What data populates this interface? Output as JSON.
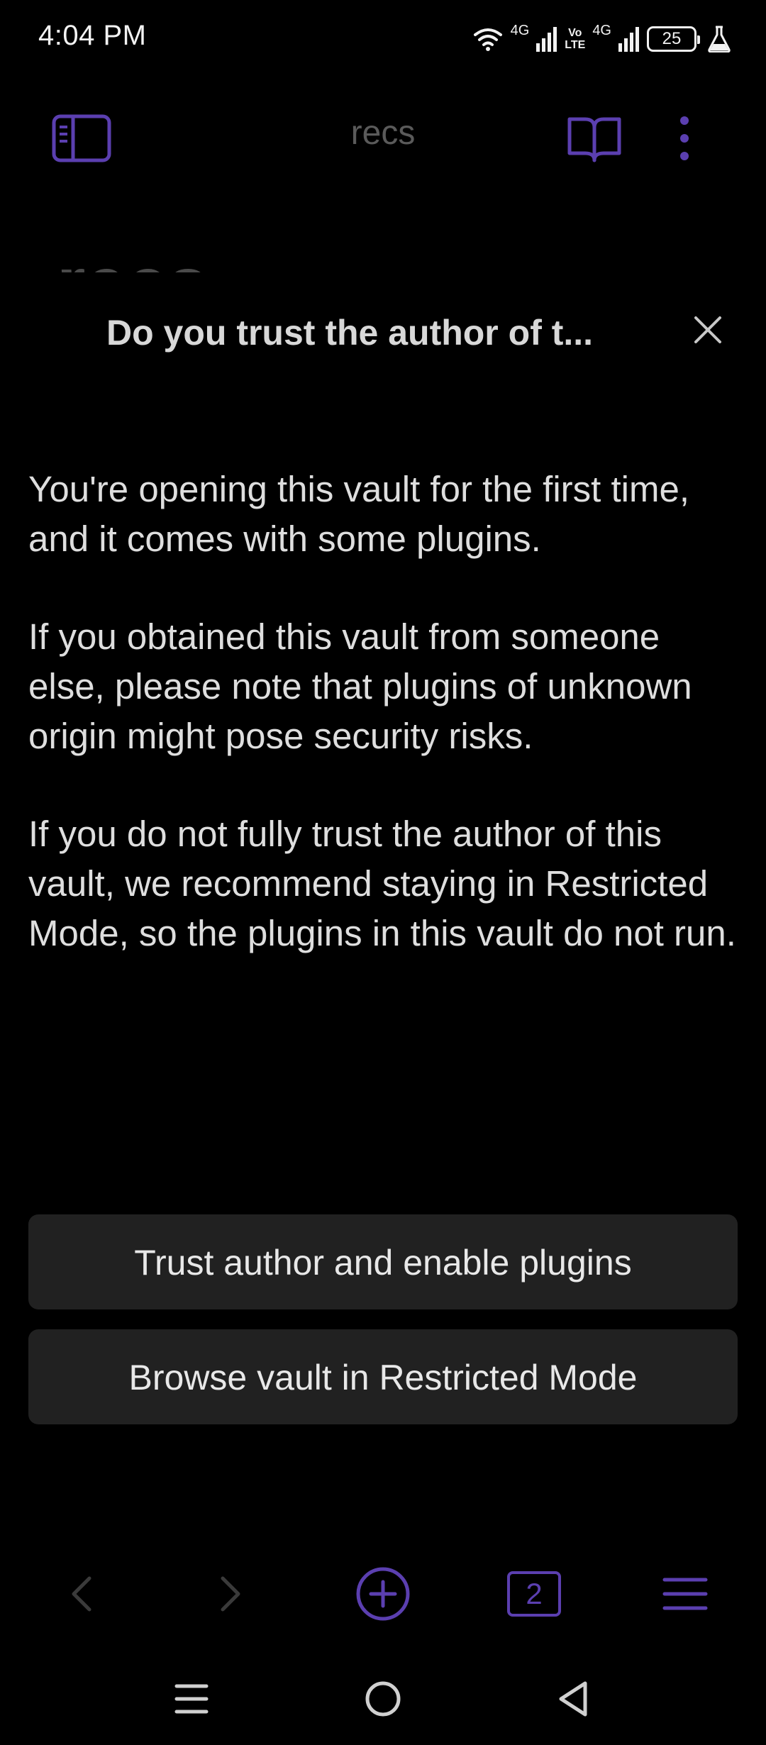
{
  "status_bar": {
    "time": "4:04 PM",
    "network_label_1": "4G",
    "volte_top": "Vo",
    "volte_bottom": "LTE",
    "network_label_2": "4G",
    "battery_level": "25"
  },
  "toolbar": {
    "title": "recs"
  },
  "note": {
    "heading": "recs"
  },
  "modal": {
    "title": "Do you trust the author of t...",
    "paragraphs": [
      "You're opening this vault for the first time, and it comes with some plugins.",
      "If you obtained this vault from someone else, please note that plugins of unknown origin might pose security risks.",
      "If you do not fully trust the author of this vault, we recommend staying in Restricted Mode, so the plugins in this vault do not run."
    ],
    "trust_button": "Trust author and enable plugins",
    "restricted_button": "Browse vault in Restricted Mode"
  },
  "bottom_nav": {
    "tab_count": "2"
  },
  "colors": {
    "background": "#000000",
    "accent": "#5b3fb0",
    "button_bg": "#212121",
    "text": "#dedede",
    "muted": "#5a5a5a"
  },
  "icons": {
    "sidebar_toggle": "sidebar-icon",
    "reading_mode": "book-open-icon",
    "more_options": "more-vertical-icon",
    "close": "close-icon",
    "back": "chevron-left-icon",
    "forward": "chevron-right-icon",
    "new_note": "plus-circle-icon",
    "menu": "menu-icon"
  }
}
